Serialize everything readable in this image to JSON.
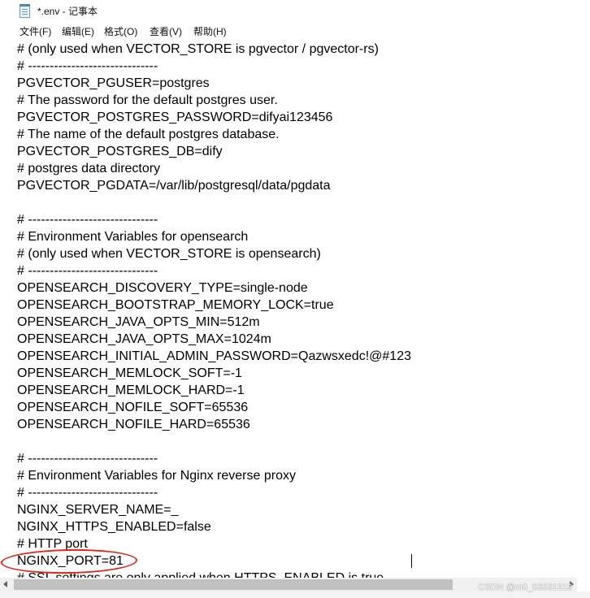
{
  "window": {
    "title": "*.env - 记事本",
    "app_icon": "notepad-icon"
  },
  "menu": {
    "items": [
      {
        "label": "文件(F)"
      },
      {
        "label": "编辑(E)"
      },
      {
        "label": "格式(O)"
      },
      {
        "label": "查看(V)"
      },
      {
        "label": "帮助(H)"
      }
    ]
  },
  "editor": {
    "lines": [
      "# (only used when VECTOR_STORE is pgvector / pgvector-rs)",
      "# ------------------------------",
      "PGVECTOR_PGUSER=postgres",
      "# The password for the default postgres user.",
      "PGVECTOR_POSTGRES_PASSWORD=difyai123456",
      "# The name of the default postgres database.",
      "PGVECTOR_POSTGRES_DB=dify",
      "# postgres data directory",
      "PGVECTOR_PGDATA=/var/lib/postgresql/data/pgdata",
      "",
      "# ------------------------------",
      "# Environment Variables for opensearch",
      "# (only used when VECTOR_STORE is opensearch)",
      "# ------------------------------",
      "OPENSEARCH_DISCOVERY_TYPE=single-node",
      "OPENSEARCH_BOOTSTRAP_MEMORY_LOCK=true",
      "OPENSEARCH_JAVA_OPTS_MIN=512m",
      "OPENSEARCH_JAVA_OPTS_MAX=1024m",
      "OPENSEARCH_INITIAL_ADMIN_PASSWORD=Qazwsxedc!@#123",
      "OPENSEARCH_MEMLOCK_SOFT=-1",
      "OPENSEARCH_MEMLOCK_HARD=-1",
      "OPENSEARCH_NOFILE_SOFT=65536",
      "OPENSEARCH_NOFILE_HARD=65536",
      "",
      "# ------------------------------",
      "# Environment Variables for Nginx reverse proxy",
      "# ------------------------------",
      "NGINX_SERVER_NAME=_",
      "NGINX_HTTPS_ENABLED=false",
      "# HTTP port",
      "NGINX_PORT=81",
      "# SSL settings are only applied when HTTPS_ENABLED is true"
    ]
  },
  "annotation": {
    "color": "#e0281c"
  },
  "watermark": "CSDN @m0_53531319"
}
